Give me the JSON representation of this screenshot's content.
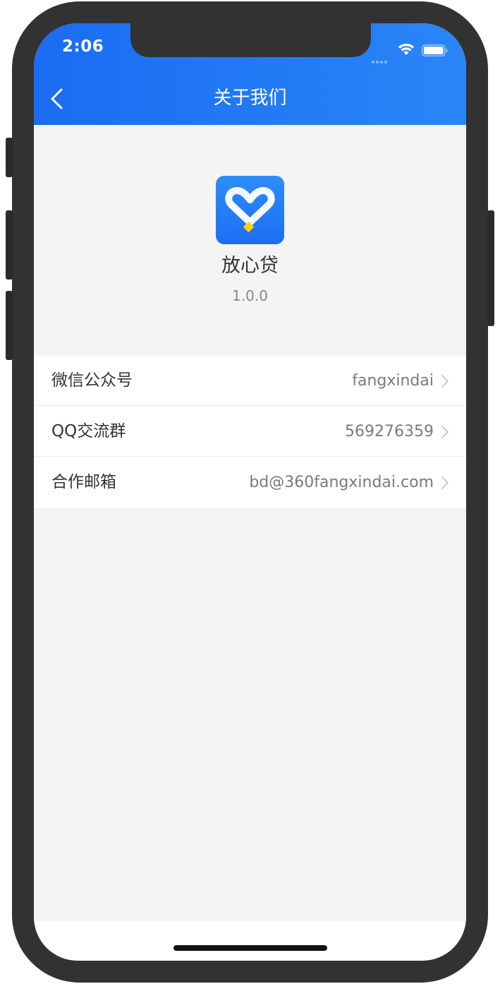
{
  "status_bar": {
    "time": "2:06"
  },
  "nav": {
    "title": "关于我们",
    "back_icon": "chevron-left-icon"
  },
  "app": {
    "name": "放心贷",
    "version": "1.0.0",
    "logo_icon": "heart-logo-icon"
  },
  "list": {
    "items": [
      {
        "label": "微信公众号",
        "value": "fangxindai"
      },
      {
        "label": "QQ交流群",
        "value": "569276359"
      },
      {
        "label": "合作邮箱",
        "value": "bd@360fangxindai.com"
      }
    ]
  },
  "colors": {
    "header_start": "#1a6cf2",
    "header_end": "#2a86f6",
    "background": "#f4f4f4",
    "accent_yellow": "#ffd400"
  }
}
